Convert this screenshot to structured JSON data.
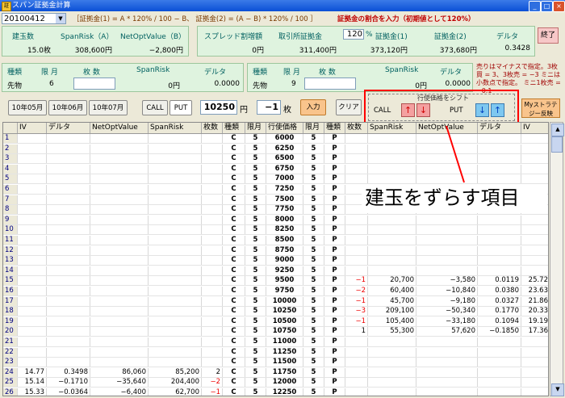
{
  "window": {
    "title": "スパン証拠金計算",
    "icon_text": "証"
  },
  "top": {
    "date_value": "20100412",
    "formula": "［証拠金(1) = A * 120% / 100 − B、 証拠金(2) = (A − B) * 120% / 100 ］",
    "note": "証拠金の割合を入力（初期値として120%）"
  },
  "summary": {
    "headers": [
      "建玉数",
      "SpanRisk（A）",
      "NetOptValue（B）"
    ],
    "values": [
      "15.0枚",
      "308,600円",
      "−2,800円"
    ]
  },
  "margin": {
    "headers": [
      "スプレッド割増額",
      "取引所証拠金",
      "証拠金(1)",
      "証拠金(2)",
      "デルタ"
    ],
    "values": [
      "0円",
      "311,400円",
      "373,120円",
      "373,680円",
      "0.3428"
    ],
    "pct_value": "120",
    "pct_unit": "%"
  },
  "exit_label": "終了",
  "futures_left": {
    "headers": [
      "種類",
      "限 月",
      "枚 数",
      "SpanRisk",
      "デルタ"
    ],
    "values": [
      "先物",
      "6",
      "",
      "0円",
      "0.0000"
    ]
  },
  "futures_right": {
    "headers": [
      "種類",
      "限 月",
      "枚 数",
      "SpanRisk",
      "デルタ"
    ],
    "values": [
      "先物",
      "9",
      "",
      "0円",
      "0.0000"
    ]
  },
  "hint": "売りはマイナスで指定。3枚買 = 3、3枚売 = −3 ミニは小数点で指定。 ミニ1枚売 = −0.1",
  "controls": {
    "months": [
      "10年05月",
      "10年06月",
      "10年07月"
    ],
    "call": "CALL",
    "put": "PUT",
    "strike": "10250",
    "strike_unit": "円",
    "qty": "−1",
    "qty_unit": "枚",
    "enter": "入力",
    "clear": "クリア"
  },
  "shift": {
    "title": "行使価格をシフト",
    "call": "CALL",
    "put": "PUT",
    "up": "↑",
    "down": "↓"
  },
  "strategy": "Myストラテジー反映",
  "annotation": "建玉をずらす項目",
  "accent": {
    "red": "#e00000",
    "frame": "#ff0000",
    "panel": "#dff3df",
    "title": "#0a4fd6"
  },
  "table": {
    "columns": [
      "",
      "IV",
      "デルタ",
      "NetOptValue",
      "SpanRisk",
      "枚数",
      "種類",
      "限月",
      "行使価格",
      "限月",
      "種類",
      "枚数",
      "SpanRisk",
      "NetOptValue",
      "デルタ",
      "IV"
    ],
    "rows": [
      [
        "1",
        "",
        "",
        "",
        "",
        "",
        "C",
        "5",
        "6000",
        "5",
        "P",
        "",
        "",
        "",
        "",
        ""
      ],
      [
        "2",
        "",
        "",
        "",
        "",
        "",
        "C",
        "5",
        "6250",
        "5",
        "P",
        "",
        "",
        "",
        "",
        ""
      ],
      [
        "3",
        "",
        "",
        "",
        "",
        "",
        "C",
        "5",
        "6500",
        "5",
        "P",
        "",
        "",
        "",
        "",
        ""
      ],
      [
        "4",
        "",
        "",
        "",
        "",
        "",
        "C",
        "5",
        "6750",
        "5",
        "P",
        "",
        "",
        "",
        "",
        ""
      ],
      [
        "5",
        "",
        "",
        "",
        "",
        "",
        "C",
        "5",
        "7000",
        "5",
        "P",
        "",
        "",
        "",
        "",
        ""
      ],
      [
        "6",
        "",
        "",
        "",
        "",
        "",
        "C",
        "5",
        "7250",
        "5",
        "P",
        "",
        "",
        "",
        "",
        ""
      ],
      [
        "7",
        "",
        "",
        "",
        "",
        "",
        "C",
        "5",
        "7500",
        "5",
        "P",
        "",
        "",
        "",
        "",
        ""
      ],
      [
        "8",
        "",
        "",
        "",
        "",
        "",
        "C",
        "5",
        "7750",
        "5",
        "P",
        "",
        "",
        "",
        "",
        ""
      ],
      [
        "9",
        "",
        "",
        "",
        "",
        "",
        "C",
        "5",
        "8000",
        "5",
        "P",
        "",
        "",
        "",
        "",
        ""
      ],
      [
        "10",
        "",
        "",
        "",
        "",
        "",
        "C",
        "5",
        "8250",
        "5",
        "P",
        "",
        "",
        "",
        "",
        ""
      ],
      [
        "11",
        "",
        "",
        "",
        "",
        "",
        "C",
        "5",
        "8500",
        "5",
        "P",
        "",
        "",
        "",
        "",
        ""
      ],
      [
        "12",
        "",
        "",
        "",
        "",
        "",
        "C",
        "5",
        "8750",
        "5",
        "P",
        "",
        "",
        "",
        "",
        ""
      ],
      [
        "13",
        "",
        "",
        "",
        "",
        "",
        "C",
        "5",
        "9000",
        "5",
        "P",
        "",
        "",
        "",
        "",
        ""
      ],
      [
        "14",
        "",
        "",
        "",
        "",
        "",
        "C",
        "5",
        "9250",
        "5",
        "P",
        "",
        "",
        "",
        "",
        ""
      ],
      [
        "15",
        "",
        "",
        "",
        "",
        "",
        "C",
        "5",
        "9500",
        "5",
        "P",
        "−1",
        "20,700",
        "−3,580",
        "0.0119",
        "25.72"
      ],
      [
        "16",
        "",
        "",
        "",
        "",
        "",
        "C",
        "5",
        "9750",
        "5",
        "P",
        "−2",
        "60,400",
        "−10,840",
        "0.0380",
        "23.63"
      ],
      [
        "17",
        "",
        "",
        "",
        "",
        "",
        "C",
        "5",
        "10000",
        "5",
        "P",
        "−1",
        "45,700",
        "−9,180",
        "0.0327",
        "21.86"
      ],
      [
        "18",
        "",
        "",
        "",
        "",
        "",
        "C",
        "5",
        "10250",
        "5",
        "P",
        "−3",
        "209,100",
        "−50,340",
        "0.1770",
        "20.33"
      ],
      [
        "19",
        "",
        "",
        "",
        "",
        "",
        "C",
        "5",
        "10500",
        "5",
        "P",
        "−1",
        "105,400",
        "−33,180",
        "0.1094",
        "19.19"
      ],
      [
        "20",
        "",
        "",
        "",
        "",
        "",
        "C",
        "5",
        "10750",
        "5",
        "P",
        "1",
        "55,300",
        "57,620",
        "−0.1850",
        "17.36"
      ],
      [
        "21",
        "",
        "",
        "",
        "",
        "",
        "C",
        "5",
        "11000",
        "5",
        "P",
        "",
        "",
        "",
        "",
        ""
      ],
      [
        "22",
        "",
        "",
        "",
        "",
        "",
        "C",
        "5",
        "11250",
        "5",
        "P",
        "",
        "",
        "",
        "",
        ""
      ],
      [
        "23",
        "",
        "",
        "",
        "",
        "",
        "C",
        "5",
        "11500",
        "5",
        "P",
        "",
        "",
        "",
        "",
        ""
      ],
      [
        "24",
        "14.77",
        "0.3498",
        "86,060",
        "85,200",
        "2",
        "C",
        "5",
        "11750",
        "5",
        "P",
        "",
        "",
        "",
        "",
        ""
      ],
      [
        "25",
        "15.14",
        "−0.1710",
        "−35,640",
        "204,400",
        "−2",
        "C",
        "5",
        "12000",
        "5",
        "P",
        "",
        "",
        "",
        "",
        ""
      ],
      [
        "26",
        "15.33",
        "−0.0364",
        "−6,400",
        "62,700",
        "−1",
        "C",
        "5",
        "12250",
        "5",
        "P",
        "",
        "",
        "",
        "",
        ""
      ]
    ]
  }
}
